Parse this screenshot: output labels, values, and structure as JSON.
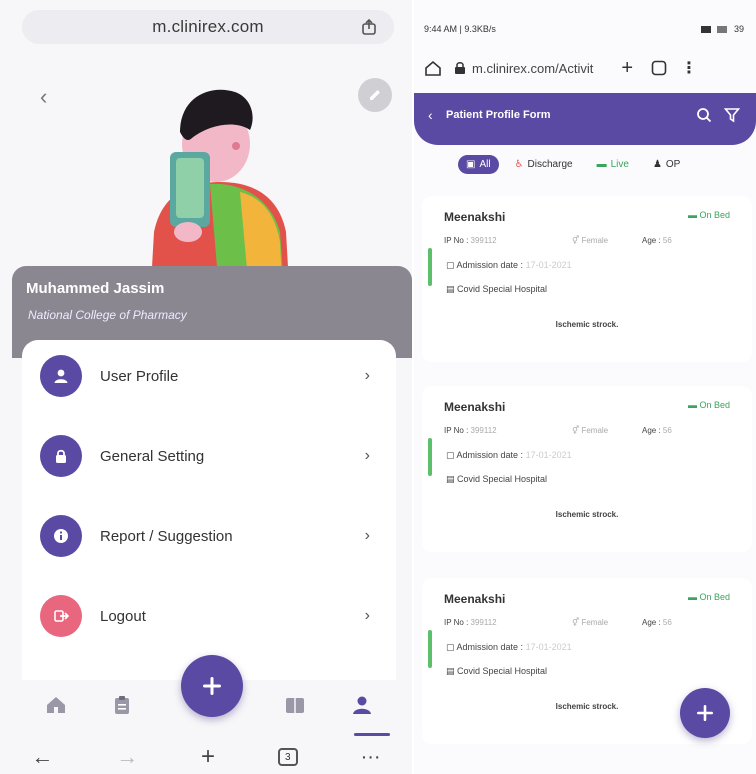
{
  "left": {
    "url": "m.clinirex.com",
    "profile": {
      "name": "Muhammed Jassim",
      "college": "National College of Pharmacy"
    },
    "menu": [
      {
        "label": "User Profile",
        "icon": "user-icon"
      },
      {
        "label": "General Setting",
        "icon": "lock-icon"
      },
      {
        "label": "Report / Suggestion",
        "icon": "info-icon"
      },
      {
        "label": "Logout",
        "icon": "logout-icon"
      }
    ],
    "browser": {
      "tab_count": "3"
    }
  },
  "right": {
    "status": {
      "left": "9:44 AM | 9.3KB/s",
      "right": "39"
    },
    "url": "m.clinirex.com/Activit",
    "header_title": "Patient Profile Form",
    "filters": [
      {
        "label": "All"
      },
      {
        "label": "Discharge"
      },
      {
        "label": "Live"
      },
      {
        "label": "OP"
      }
    ],
    "patients": [
      {
        "name": "Meenakshi",
        "status": "On Bed",
        "ip_label": "IP No : ",
        "ip_no": "399112",
        "gender": "Female",
        "age_label": "Age : ",
        "age": "56",
        "admission_label": "Admission date : ",
        "admission_date": "17-01-2021",
        "hospital": "Covid Special Hospital",
        "diagnosis": "Ischemic strock."
      },
      {
        "name": "Meenakshi",
        "status": "On Bed",
        "ip_label": "IP No : ",
        "ip_no": "399112",
        "gender": "Female",
        "age_label": "Age : ",
        "age": "56",
        "admission_label": "Admission date : ",
        "admission_date": "17-01-2021",
        "hospital": "Covid Special Hospital",
        "diagnosis": "Ischemic strock."
      },
      {
        "name": "Meenakshi",
        "status": "On Bed",
        "ip_label": "IP No : ",
        "ip_no": "399112",
        "gender": "Female",
        "age_label": "Age : ",
        "age": "56",
        "admission_label": "Admission date : ",
        "admission_date": "17-01-2021",
        "hospital": "Covid Special Hospital",
        "diagnosis": "Ischemic strock."
      }
    ]
  },
  "colors": {
    "primary": "#5a4aa3",
    "logout": "#e8667e",
    "live_green": "#3aa55c",
    "discharge_red": "#e05454"
  }
}
